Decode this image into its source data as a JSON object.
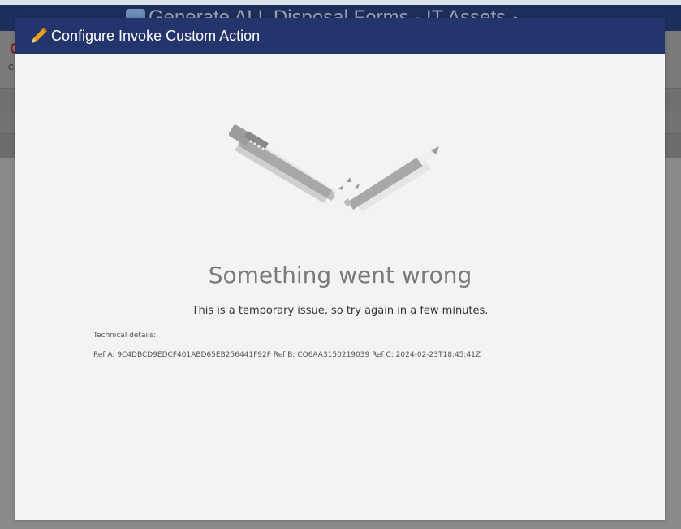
{
  "background": {
    "header_title": "Generate ALL Disposal Forms - IT Assets",
    "toolbar_fragment_1": "C",
    "toolbar_fragment_2": "Cl"
  },
  "dialog": {
    "title": "Configure Invoke Custom Action",
    "title_icon": "pencil-icon"
  },
  "error": {
    "title": "Something went wrong",
    "subtitle": "This is a temporary issue, so try again in a few minutes.",
    "technical_label": "Technical details:",
    "ref_a_label": "Ref A: ",
    "ref_a": "9C4DBCD9EDCF401ABD65EB256441F92F",
    "ref_b_label": " Ref B: ",
    "ref_b": "CO6AA3150219039",
    "ref_c_label": " Ref C: ",
    "ref_c": "2024-02-23T18:45:41Z"
  },
  "colors": {
    "titlebar": "#24346c",
    "dialog_bg": "#f3f3f3",
    "pencil_accent": "#e8a21a"
  }
}
